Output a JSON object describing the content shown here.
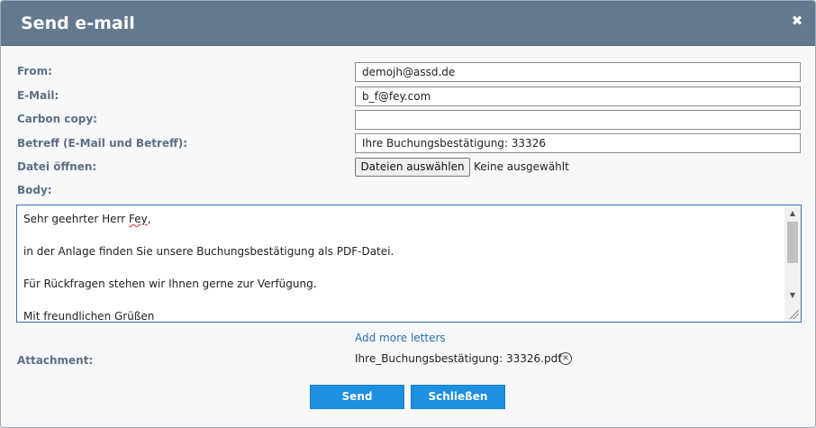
{
  "dialog": {
    "title": "Send e-mail",
    "close_glyph": "✖"
  },
  "labels": {
    "from": "From:",
    "email": "E-Mail:",
    "cc": "Carbon copy:",
    "subject": "Betreff (E-Mail und Betreff):",
    "file": "Datei öffnen:",
    "body": "Body:",
    "attachment": "Attachment:"
  },
  "fields": {
    "from": "demojh@assd.de",
    "email": "b_f@fey.com",
    "cc": "",
    "subject": "Ihre Buchungsbestätigung: 33326"
  },
  "file_input": {
    "button_label": "Dateien auswählen",
    "status": "Keine ausgewählt"
  },
  "body": {
    "greeting_prefix": "Sehr geehrter Herr ",
    "greeting_name": "Fey",
    "greeting_suffix": ",",
    "line2": "in der Anlage finden Sie unsere Buchungsbestätigung als PDF-Datei.",
    "line3": "Für Rückfragen stehen wir Ihnen gerne zur Verfügung.",
    "line4": "Mit freundlichen Grüßen"
  },
  "links": {
    "add_more": "Add more letters"
  },
  "attachment": {
    "filename": "Ihre_Buchungsbestätigung: 33326.pdf",
    "remove_glyph": "✕"
  },
  "buttons": {
    "send": "Send",
    "close": "Schließen"
  },
  "icons": {
    "close": "close-icon",
    "remove": "remove-circle-icon"
  },
  "colors": {
    "titlebar": "#64798f",
    "label": "#5d6f86",
    "accent": "#1e8fe1",
    "link": "#2a6db3"
  }
}
